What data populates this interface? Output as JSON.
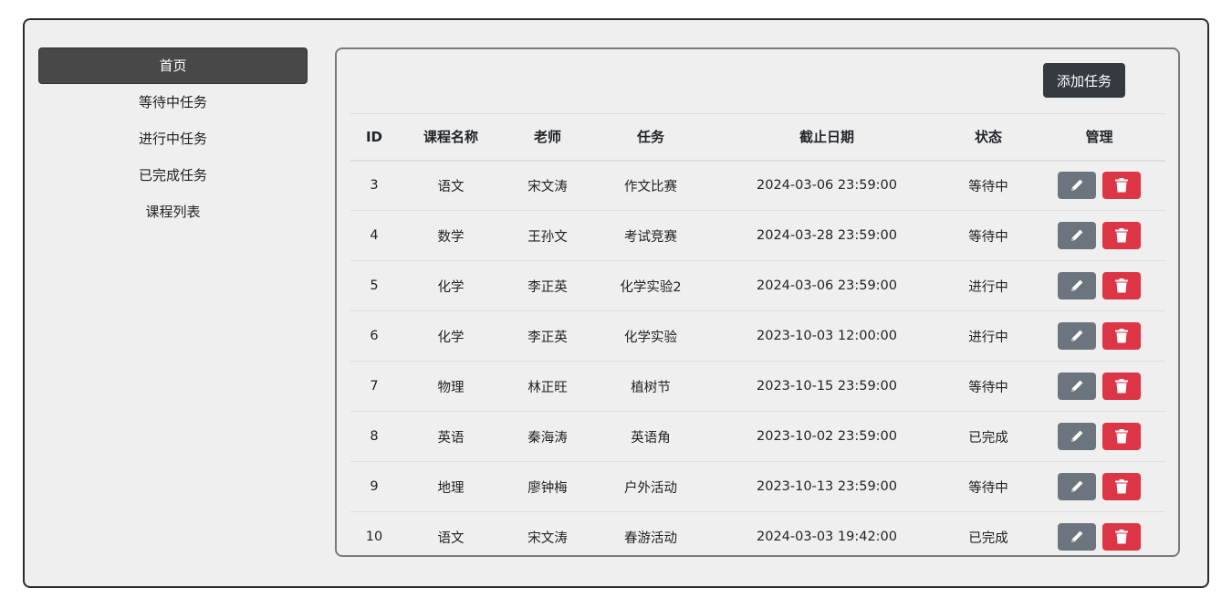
{
  "sidebar": {
    "items": [
      {
        "label": "首页",
        "active": true
      },
      {
        "label": "等待中任务"
      },
      {
        "label": "进行中任务"
      },
      {
        "label": "已完成任务"
      },
      {
        "label": "课程列表"
      }
    ]
  },
  "toolbar": {
    "add_label": "添加任务"
  },
  "table": {
    "headers": [
      "ID",
      "课程名称",
      "老师",
      "任务",
      "截止日期",
      "状态",
      "管理"
    ],
    "rows": [
      {
        "id": "3",
        "course": "语文",
        "teacher": "宋文涛",
        "task": "作文比赛",
        "due": "2024-03-06 23:59:00",
        "status": "等待中"
      },
      {
        "id": "4",
        "course": "数学",
        "teacher": "王孙文",
        "task": "考试竞赛",
        "due": "2024-03-28 23:59:00",
        "status": "等待中"
      },
      {
        "id": "5",
        "course": "化学",
        "teacher": "李正英",
        "task": "化学实验2",
        "due": "2024-03-06 23:59:00",
        "status": "进行中"
      },
      {
        "id": "6",
        "course": "化学",
        "teacher": "李正英",
        "task": "化学实验",
        "due": "2023-10-03 12:00:00",
        "status": "进行中"
      },
      {
        "id": "7",
        "course": "物理",
        "teacher": "林正旺",
        "task": "植树节",
        "due": "2023-10-15 23:59:00",
        "status": "等待中"
      },
      {
        "id": "8",
        "course": "英语",
        "teacher": "秦海涛",
        "task": "英语角",
        "due": "2023-10-02 23:59:00",
        "status": "已完成"
      },
      {
        "id": "9",
        "course": "地理",
        "teacher": "廖钟梅",
        "task": "户外活动",
        "due": "2023-10-13 23:59:00",
        "status": "等待中"
      },
      {
        "id": "10",
        "course": "语文",
        "teacher": "宋文涛",
        "task": "春游活动",
        "due": "2024-03-03 19:42:00",
        "status": "已完成"
      }
    ]
  },
  "icons": {
    "edit": "pencil-icon",
    "delete": "trash-icon"
  },
  "colors": {
    "edit_button": "#6c757d",
    "delete_button": "#dc3545",
    "active_nav": "#484848",
    "add_button": "#343a40"
  }
}
